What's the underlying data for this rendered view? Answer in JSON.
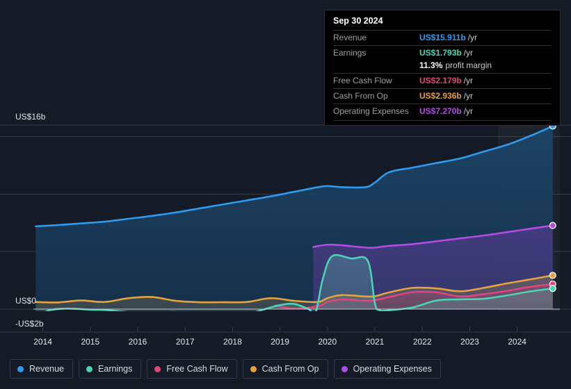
{
  "tooltip": {
    "date": "Sep 30 2024",
    "rows": [
      {
        "label": "Revenue",
        "value": "US$15.911b",
        "unit": "/yr",
        "color": "#2d9bf0"
      },
      {
        "label": "Earnings",
        "value": "US$1.793b",
        "unit": "/yr",
        "color": "#4ad4b4"
      },
      {
        "label": "Free Cash Flow",
        "value": "US$2.179b",
        "unit": "/yr",
        "color": "#e0457b"
      },
      {
        "label": "Cash From Op",
        "value": "US$2.936b",
        "unit": "/yr",
        "color": "#e8a33d"
      },
      {
        "label": "Operating Expenses",
        "value": "US$7.270b",
        "unit": "/yr",
        "color": "#b44ae8"
      }
    ],
    "profit_margin_value": "11.3%",
    "profit_margin_text": "profit margin"
  },
  "legend": {
    "items": [
      {
        "label": "Revenue",
        "color": "#2d9bf0"
      },
      {
        "label": "Earnings",
        "color": "#4ad4b4"
      },
      {
        "label": "Free Cash Flow",
        "color": "#e0457b"
      },
      {
        "label": "Cash From Op",
        "color": "#e8a33d"
      },
      {
        "label": "Operating Expenses",
        "color": "#b44ae8"
      }
    ]
  },
  "chart_data": {
    "type": "area",
    "title": "",
    "xlabel": "",
    "ylabel": "",
    "currency": "US$",
    "units": "billions per year",
    "ylim": [
      -2,
      16
    ],
    "grid": true,
    "legend_position": "bottom",
    "y_ticks": [
      {
        "value": 16,
        "label": "US$16b"
      },
      {
        "value": 0,
        "label": "US$0"
      },
      {
        "value": -2,
        "label": "-US$2b"
      }
    ],
    "x_tick_labels": [
      "2014",
      "2015",
      "2016",
      "2017",
      "2018",
      "2019",
      "2020",
      "2021",
      "2022",
      "2023",
      "2024"
    ],
    "x_range": [
      "2013.8",
      "2024.9"
    ],
    "highlight_band": {
      "from": "2023.6",
      "to": "2024.9",
      "note": "forecast-band"
    },
    "series": [
      {
        "name": "Revenue",
        "color": "#2d9bf0",
        "fill": "#193450",
        "x": [
          2013.85,
          2014.3,
          2014.8,
          2015.3,
          2015.8,
          2016.3,
          2016.8,
          2017.3,
          2017.8,
          2018.3,
          2018.8,
          2019.3,
          2019.8,
          2020.0,
          2020.3,
          2020.8,
          2021.0,
          2021.3,
          2021.8,
          2022.3,
          2022.8,
          2023.3,
          2023.8,
          2024.3,
          2024.75
        ],
        "values": [
          7.2,
          7.3,
          7.45,
          7.6,
          7.85,
          8.1,
          8.4,
          8.75,
          9.1,
          9.45,
          9.8,
          10.2,
          10.6,
          10.7,
          10.6,
          10.6,
          11.0,
          11.9,
          12.3,
          12.7,
          13.1,
          13.7,
          14.3,
          15.1,
          15.911
        ]
      },
      {
        "name": "Operating Expenses",
        "color": "#b44ae8",
        "fill": "#3a3a6e",
        "x": [
          2019.7,
          2020.0,
          2020.3,
          2020.8,
          2021.0,
          2021.3,
          2021.8,
          2022.3,
          2022.8,
          2023.3,
          2023.8,
          2024.3,
          2024.75
        ],
        "values": [
          5.4,
          5.6,
          5.55,
          5.35,
          5.35,
          5.5,
          5.65,
          5.9,
          6.15,
          6.4,
          6.7,
          7.0,
          7.27
        ]
      },
      {
        "name": "Cash From Op",
        "color": "#e8a33d",
        "x": [
          2013.85,
          2014.3,
          2014.8,
          2015.3,
          2015.8,
          2016.3,
          2016.8,
          2017.3,
          2017.8,
          2018.3,
          2018.8,
          2019.3,
          2019.8,
          2020.0,
          2020.3,
          2020.8,
          2021.0,
          2021.3,
          2021.8,
          2022.3,
          2022.8,
          2023.3,
          2023.8,
          2024.3,
          2024.75
        ],
        "values": [
          0.62,
          0.58,
          0.75,
          0.62,
          0.95,
          1.05,
          0.72,
          0.6,
          0.6,
          0.62,
          0.95,
          0.72,
          0.62,
          0.95,
          1.22,
          1.1,
          1.12,
          1.45,
          1.85,
          1.8,
          1.55,
          1.85,
          2.25,
          2.6,
          2.936
        ]
      },
      {
        "name": "Free Cash Flow",
        "color": "#e0457b",
        "x": [
          2018.9,
          2019.3,
          2019.8,
          2020.0,
          2020.3,
          2020.8,
          2021.0,
          2021.3,
          2021.8,
          2022.3,
          2022.8,
          2023.3,
          2023.8,
          2024.3,
          2024.75
        ],
        "values": [
          0.3,
          0.05,
          0.25,
          0.62,
          0.85,
          0.72,
          0.78,
          1.05,
          1.48,
          1.45,
          1.1,
          1.3,
          1.6,
          1.95,
          2.179
        ]
      },
      {
        "name": "Earnings",
        "color": "#4ad4b4",
        "x": [
          2013.85,
          2014.1,
          2014.5,
          2015.0,
          2015.4,
          2015.9,
          2016.3,
          2016.8,
          2017.2,
          2017.7,
          2018.2,
          2018.6,
          2019.0,
          2019.3,
          2019.6,
          2019.75,
          2019.9,
          2020.1,
          2020.5,
          2020.85,
          2021.0,
          2021.1,
          2021.3,
          2021.8,
          2022.3,
          2022.8,
          2023.3,
          2023.8,
          2024.3,
          2024.75
        ],
        "values": [
          -0.9,
          -0.15,
          0.05,
          -0.05,
          -0.1,
          -0.3,
          -0.35,
          -0.25,
          -0.55,
          -0.4,
          -0.6,
          -0.1,
          0.35,
          0.45,
          0.0,
          -0.3,
          2.6,
          4.6,
          4.4,
          4.2,
          0.5,
          -0.1,
          -0.1,
          0.15,
          0.75,
          0.85,
          0.9,
          1.2,
          1.55,
          1.793
        ]
      }
    ]
  }
}
